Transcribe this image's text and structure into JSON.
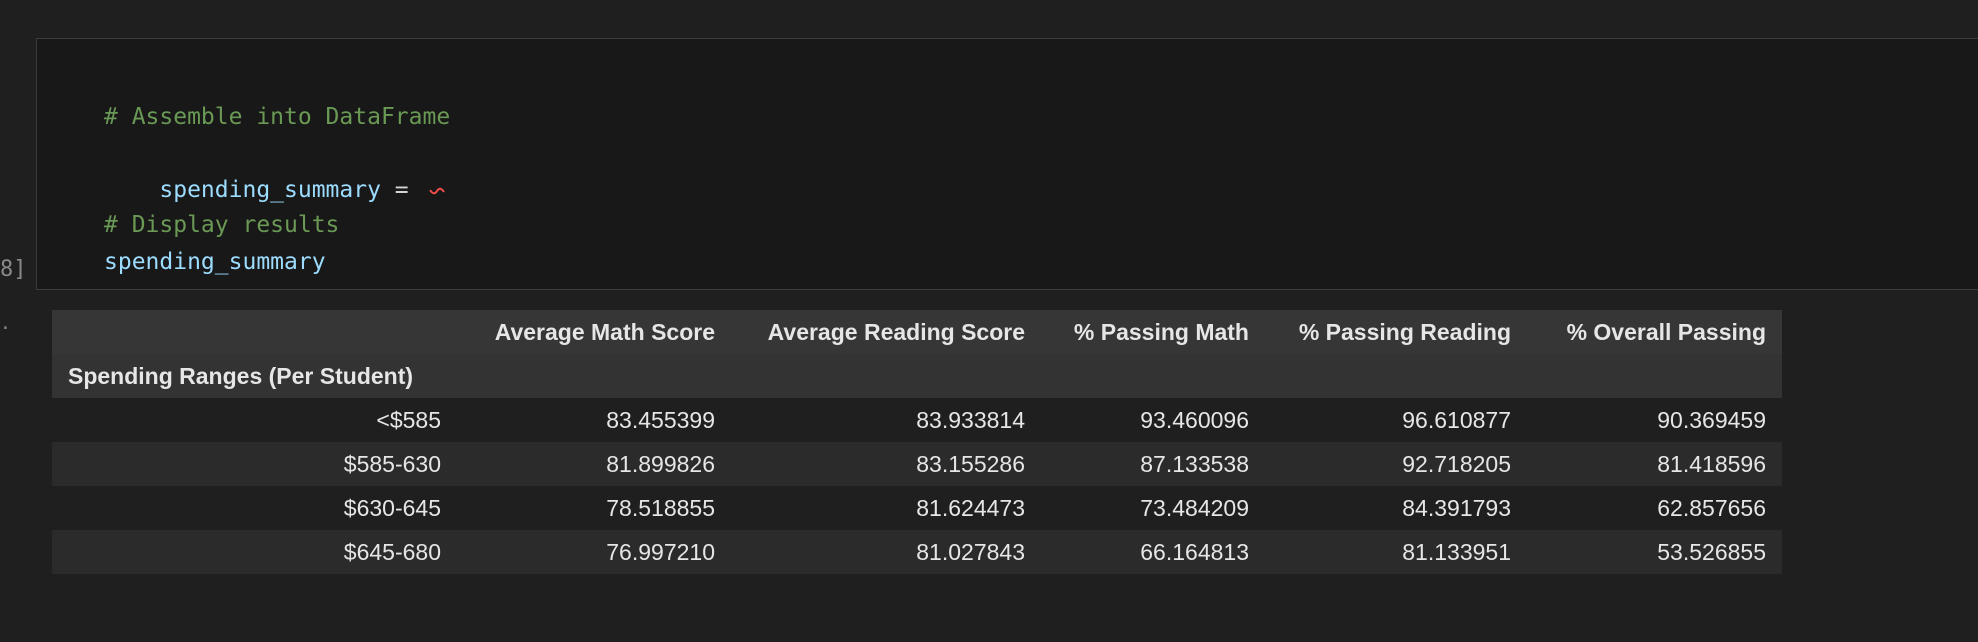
{
  "code_cell": {
    "lines": [
      {
        "text": "# Assemble into DataFrame",
        "kind": "comment"
      },
      {
        "ident": "spending_summary",
        "op": " = ",
        "kind": "assign"
      },
      {
        "text": "",
        "kind": "blank"
      },
      {
        "text": "# Display results",
        "kind": "comment"
      },
      {
        "text": "spending_summary",
        "kind": "ident"
      }
    ],
    "execution_count": "8]",
    "output_marker": "."
  },
  "table": {
    "columns": [
      "Average Math Score",
      "Average Reading Score",
      "% Passing Math",
      "% Passing Reading",
      "% Overall Passing"
    ],
    "index_name": "Spending Ranges (Per Student)",
    "rows": [
      {
        "index": "<$585",
        "values": [
          "83.455399",
          "83.933814",
          "93.460096",
          "96.610877",
          "90.369459"
        ]
      },
      {
        "index": "$585-630",
        "values": [
          "81.899826",
          "83.155286",
          "87.133538",
          "92.718205",
          "81.418596"
        ]
      },
      {
        "index": "$630-645",
        "values": [
          "78.518855",
          "81.624473",
          "73.484209",
          "84.391793",
          "62.857656"
        ]
      },
      {
        "index": "$645-680",
        "values": [
          "76.997210",
          "81.027843",
          "66.164813",
          "81.133951",
          "53.526855"
        ]
      }
    ]
  },
  "colors": {
    "background": "#1f1f1f",
    "comment": "#6a9955",
    "identifier": "#9cdcfe",
    "error_squiggle": "#f14c4c"
  }
}
